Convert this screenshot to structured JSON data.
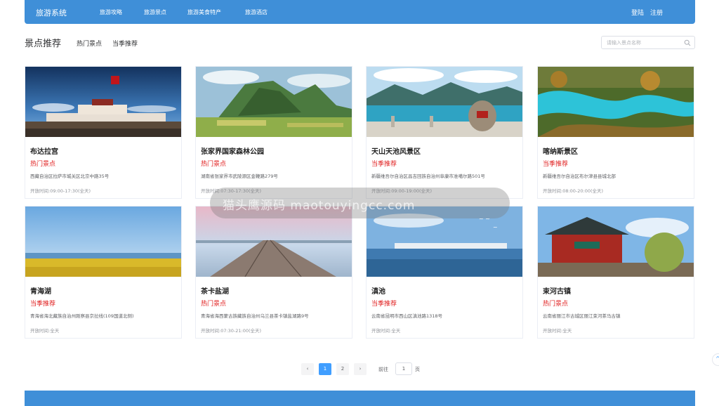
{
  "header": {
    "brand": "旅游系统",
    "nav": [
      "旅游攻略",
      "旅游景点",
      "旅游美食特产",
      "旅游酒店"
    ],
    "login": "登陆",
    "register": "注册"
  },
  "section": {
    "title": "景点推荐",
    "filters": [
      "热门景点",
      "当季推荐"
    ],
    "search_placeholder": "请输入景点名称"
  },
  "cards": [
    {
      "name": "布达拉宫",
      "tag": "热门景点",
      "address": "西藏自治区拉萨市城关区北京中路35号",
      "hours": "开放时间:09:00-17:30(全天)"
    },
    {
      "name": "张家界国家森林公园",
      "tag": "热门景点",
      "address": "湖南省张家界市武陵源区金鞭路279号",
      "hours": "开放时间:07:30-17:30(全天)"
    },
    {
      "name": "天山天池风景区",
      "tag": "当季推荐",
      "address": "新疆维吾尔自治区昌吉回族自治州阜康市准噶尔路501号",
      "hours": "开放时间:09:00-19:00(全天)"
    },
    {
      "name": "喀纳斯景区",
      "tag": "当季推荐",
      "address": "新疆维吾尔自治区布尔津县县城北部",
      "hours": "开放时间:08:00-20:00(全天)"
    },
    {
      "name": "青海湖",
      "tag": "当季推荐",
      "address": "青海省海北藏族自治州刚察县京拉线(109国道北侧)",
      "hours": "开放时间:全天"
    },
    {
      "name": "茶卡盐湖",
      "tag": "热门景点",
      "address": "青海省海西蒙古族藏族自治州乌兰县茶卡镇盐湖路9号",
      "hours": "开放时间:07:30-21:00(全天)"
    },
    {
      "name": "滇池",
      "tag": "当季推荐",
      "address": "云南省昆明市西山区滇池路1318号",
      "hours": "开放时间:全天"
    },
    {
      "name": "束河古镇",
      "tag": "热门景点",
      "address": "云南省丽江市古城区丽江束河茶马古镇",
      "hours": "开放时间:全天"
    }
  ],
  "pagination": {
    "prev": "‹",
    "pages": [
      "1",
      "2"
    ],
    "current": "1",
    "next": "›",
    "goto_label": "前往",
    "goto_value": "1",
    "goto_suffix": "页"
  },
  "watermark": "猫头鹰源码 maotouyingcc.com",
  "colors": {
    "primary": "#3f8fd8",
    "tag": "#e02020",
    "active_page": "#409eff"
  }
}
